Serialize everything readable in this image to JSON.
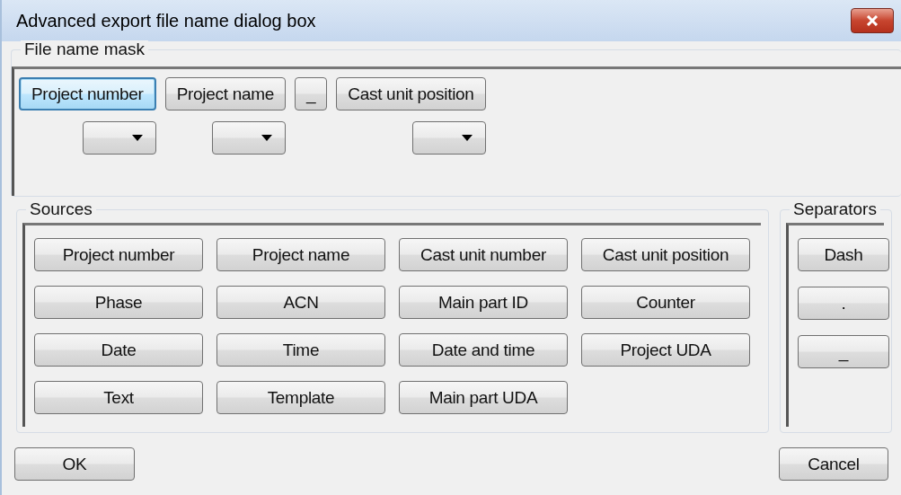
{
  "window": {
    "title": "Advanced export file name dialog box"
  },
  "mask": {
    "label": "File name mask",
    "items": [
      {
        "label": "Project number",
        "kind": "field",
        "focused": true
      },
      {
        "label": "Project name",
        "kind": "field",
        "focused": false
      },
      {
        "label": "_",
        "kind": "separator",
        "focused": false
      },
      {
        "label": "Cast unit position",
        "kind": "field",
        "focused": false
      }
    ]
  },
  "sources": {
    "label": "Sources",
    "buttons": [
      "Project number",
      "Project name",
      "Cast unit number",
      "Cast unit position",
      "Phase",
      "ACN",
      "Main part ID",
      "Counter",
      "Date",
      "Time",
      "Date and time",
      "Project UDA",
      "Text",
      "Template",
      "Main part UDA"
    ]
  },
  "separators": {
    "label": "Separators",
    "buttons": [
      "Dash",
      ".",
      "_"
    ]
  },
  "buttons": {
    "ok": "OK",
    "cancel": "Cancel"
  }
}
